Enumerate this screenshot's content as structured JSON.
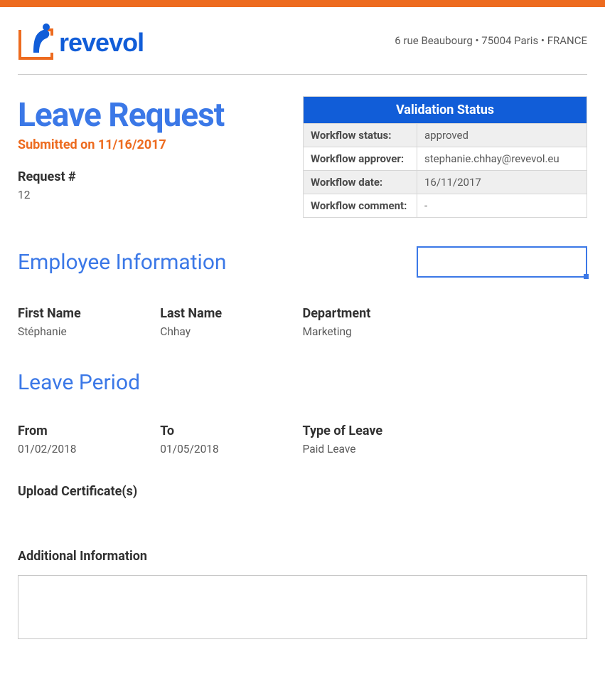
{
  "header": {
    "address": "6 rue Beaubourg • 75004 Paris • FRANCE",
    "logo_text": "revevol"
  },
  "title": "Leave Request",
  "submitted_label": "Submitted on 11/16/2017",
  "validation": {
    "header": "Validation Status",
    "rows": [
      {
        "label": "Workflow status:",
        "value": "approved"
      },
      {
        "label": "Workflow approver:",
        "value": "stephanie.chhay@revevol.eu"
      },
      {
        "label": "Workflow date:",
        "value": "16/11/2017"
      },
      {
        "label": "Workflow comment:",
        "value": "-"
      }
    ]
  },
  "request": {
    "label": "Request #",
    "value": "12"
  },
  "sections": {
    "employee": "Employee Information",
    "leave": "Leave Period"
  },
  "employee": {
    "first_name": {
      "label": "First Name",
      "value": "Stéphanie"
    },
    "last_name": {
      "label": "Last Name",
      "value": "Chhay"
    },
    "department": {
      "label": "Department",
      "value": "Marketing"
    }
  },
  "leave": {
    "from": {
      "label": "From",
      "value": "01/02/2018"
    },
    "to": {
      "label": "To",
      "value": "01/05/2018"
    },
    "type": {
      "label": "Type of Leave",
      "value": "Paid Leave"
    }
  },
  "upload_label": "Upload Certificate(s)",
  "additional_label": "Additional Information",
  "additional_value": ""
}
